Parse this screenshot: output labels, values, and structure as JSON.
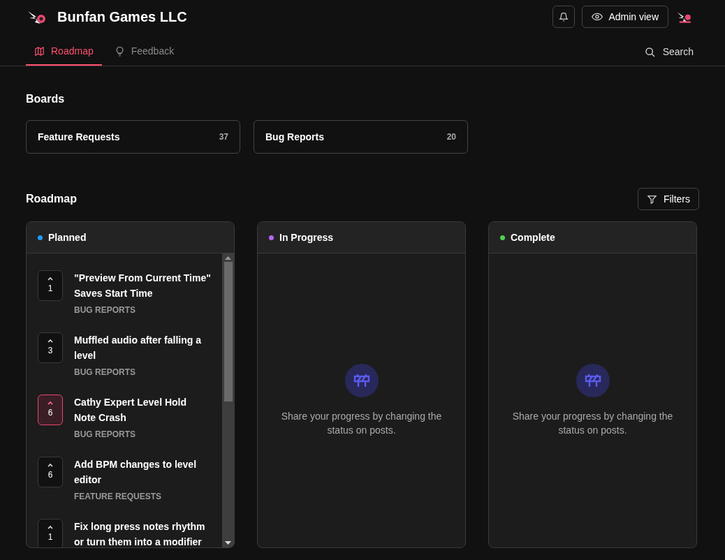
{
  "header": {
    "title": "Bunfan Games LLC",
    "admin_button": "Admin view"
  },
  "tabs": [
    {
      "label": "Roadmap",
      "kind": "map",
      "selected": true
    },
    {
      "label": "Feedback",
      "kind": "bulb",
      "selected": false
    }
  ],
  "search": {
    "label": "Search"
  },
  "boards": {
    "heading": "Boards",
    "items": [
      {
        "name": "Feature Requests",
        "count": "37"
      },
      {
        "name": "Bug Reports",
        "count": "20"
      }
    ]
  },
  "roadmap": {
    "heading": "Roadmap",
    "filters_button": "Filters",
    "columns": [
      {
        "title": "Planned",
        "color": "#1e9bff",
        "posts": [
          {
            "votes": "1",
            "voted": false,
            "title": "\"Preview From Current Time\" Saves Start Time",
            "board": "BUG REPORTS"
          },
          {
            "votes": "3",
            "voted": false,
            "title": "Muffled audio after falling a level",
            "board": "BUG REPORTS"
          },
          {
            "votes": "6",
            "voted": true,
            "title": "Cathy Expert Level Hold Note Crash",
            "board": "BUG REPORTS"
          },
          {
            "votes": "6",
            "voted": false,
            "title": "Add BPM changes to level editor",
            "board": "FEATURE REQUESTS"
          },
          {
            "votes": "1",
            "voted": false,
            "title": "Fix long press notes rhythm or turn them into a modifier"
          }
        ]
      },
      {
        "title": "In Progress",
        "color": "#b565f0",
        "empty_text": "Share your progress by changing the status on posts."
      },
      {
        "title": "Complete",
        "color": "#4fd14f",
        "empty_text": "Share your progress by changing the status on posts."
      }
    ]
  }
}
